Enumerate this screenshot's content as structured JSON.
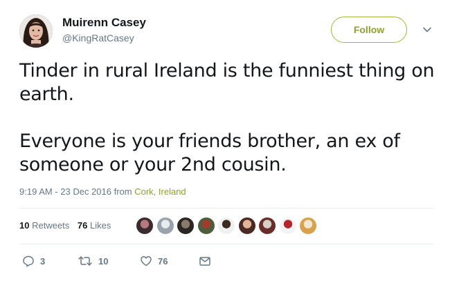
{
  "user": {
    "name": "Muirenn Casey",
    "handle": "@KingRatCasey"
  },
  "follow_label": "Follow",
  "tweet": {
    "text": "Tinder in rural Ireland is the funniest thing on\nearth.\n\nEveryone is your friends brother, an ex of\nsomeone or your 2nd cousin."
  },
  "meta": {
    "time": "9:19 AM - 23 Dec 2016",
    "from": "from",
    "location": "Cork, Ireland"
  },
  "stats": {
    "retweets_count": "10",
    "retweets_label": "Retweets",
    "likes_count": "76",
    "likes_label": "Likes"
  },
  "actions": {
    "reply_count": "3",
    "retweet_count": "10",
    "like_count": "76"
  },
  "colors": {
    "accent": "#8ea22b",
    "text": "#14171a",
    "muted": "#657786",
    "divider": "#e6ecf0"
  },
  "liker_avatars": [
    {
      "colors": [
        "#3b2a2e",
        "#b6797c"
      ]
    },
    {
      "colors": [
        "#9aa3ab",
        "#e9ecef"
      ]
    },
    {
      "colors": [
        "#2b2623",
        "#8a7a6b"
      ]
    },
    {
      "colors": [
        "#4e5d3a",
        "#a23a2e"
      ]
    },
    {
      "colors": [
        "#f0f0f0",
        "#3a2b22"
      ]
    },
    {
      "colors": [
        "#4a2a22",
        "#e0b59a"
      ]
    },
    {
      "colors": [
        "#6a2e2a",
        "#d8cfc7"
      ]
    },
    {
      "colors": [
        "#f4f4f4",
        "#b3262c"
      ]
    },
    {
      "colors": [
        "#d9a14c",
        "#f2e6d5"
      ]
    }
  ]
}
